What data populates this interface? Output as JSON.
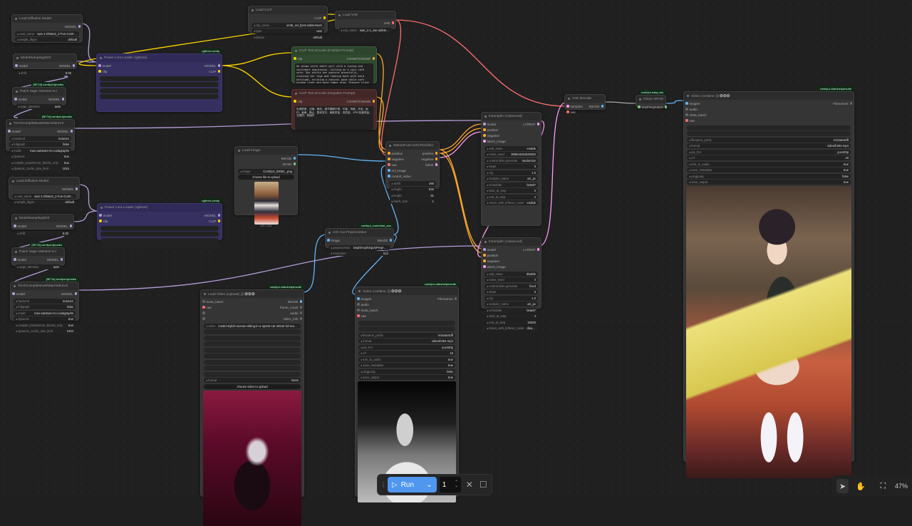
{
  "nodes": [
    {
      "id": "ldm1",
      "title": "Load Diffusion Model",
      "outputs": [
        {
          "label": "MODEL",
          "type": "MODEL"
        }
      ],
      "widgets": [
        {
          "name": "unet_name",
          "value": "wan 2.2\\Wan2_2-Fun-Control-A14B-HIGH_fp8_..."
        },
        {
          "name": "weight_dtype",
          "value": "default"
        }
      ]
    },
    {
      "id": "ms1",
      "title": "ModelSamplingSD3",
      "inputs": [
        {
          "label": "model",
          "type": "MODEL"
        }
      ],
      "outputs": [
        {
          "label": "MODEL",
          "type": "MODEL"
        }
      ],
      "widgets": [
        {
          "name": "shift",
          "value": "8.00"
        }
      ]
    },
    {
      "id": "psa1",
      "title": "Patch Sage Attention KJ",
      "badge": "[SE7A] comfyui-kjnodes",
      "inputs": [
        {
          "label": "model",
          "type": "MODEL"
        }
      ],
      "outputs": [
        {
          "label": "MODEL",
          "type": "MODEL"
        }
      ],
      "widgets": [
        {
          "name": "sage_attention",
          "value": "auto"
        }
      ]
    },
    {
      "id": "tc1",
      "title": "TorchCompileModelWanVideoV2",
      "badge": "[9E7A] comfyui-kjnodes",
      "inputs": [
        {
          "label": "model",
          "type": "MODEL"
        }
      ],
      "outputs": [
        {
          "label": "MODEL",
          "type": "MODEL"
        }
      ],
      "widgets": [
        {
          "name": "backend",
          "value": "inductor"
        },
        {
          "name": "fullgraph",
          "value": "false"
        },
        {
          "name": "mode",
          "value": "max-autotune-no-cudagraphs"
        },
        {
          "name": "dynamic",
          "value": "true"
        },
        {
          "name": "compile_transformer_blocks_only",
          "value": "true"
        },
        {
          "name": "dynamic_cache_size_limit",
          "value": "1024"
        }
      ]
    },
    {
      "id": "pll1",
      "title": "Power Lora Loader (rgthree)",
      "badge": "rgthree-comfy",
      "inputs": [
        {
          "label": "model",
          "type": "MODEL"
        },
        {
          "label": "clip",
          "type": "CLIP"
        }
      ],
      "outputs": [
        {
          "label": "MODEL",
          "type": "MODEL"
        },
        {
          "label": "CLIP",
          "type": "CLIP"
        }
      ],
      "widgets": [
        {
          "name": "",
          "value": ""
        },
        {
          "name": "",
          "value": ""
        },
        {
          "name": "",
          "value": ""
        },
        {
          "name": "",
          "value": ""
        }
      ]
    },
    {
      "id": "clip",
      "title": "Load CLIP",
      "outputs": [
        {
          "label": "CLIP",
          "type": "CLIP"
        }
      ],
      "widgets": [
        {
          "name": "clip_name",
          "value": "umt5_xxl_fp16.safetensors"
        },
        {
          "name": "type",
          "value": "wan"
        },
        {
          "name": "device",
          "value": "default"
        }
      ]
    },
    {
      "id": "vae",
      "title": "Load VAE",
      "outputs": [
        {
          "label": "VAE",
          "type": "VAE"
        }
      ],
      "widgets": [
        {
          "name": "vae_name",
          "value": "wan_2.1_vae.safetensors"
        }
      ]
    },
    {
      "id": "pos",
      "title": "CLIP Text Encode (Positive Prompt)",
      "inputs": [
        {
          "label": "clip",
          "type": "CLIP"
        }
      ],
      "outputs": [
        {
          "label": "CONDITIONING",
          "type": "COND"
        }
      ],
      "text": "An anime-style adult girl with a loving and confident expression, sitting on a cozy café sofa. She shifts her posture gracefully, crossing her legs and leaning back with bold attitude, striking a natural pose while soft window light and warm lamps glow. Glasses clink and drinks move on the table, background customers sit softly, subtle camera motion, expressive detail, professional animation quality."
    },
    {
      "id": "neg",
      "title": "CLIP Text Encode (Negative Prompt)",
      "inputs": [
        {
          "label": "clip",
          "type": "CLIP"
        }
      ],
      "outputs": [
        {
          "label": "CONDITIONING",
          "type": "COND"
        }
      ],
      "text": "色调艳丽，过曝，静态，细节模糊不清，字幕，风格，作品，画作，画面，静止，整体发灰，最差质量，低质量，JPEG压缩残留，丑陋的，残缺的"
    },
    {
      "id": "limg",
      "title": "Load Image",
      "outputs": [
        {
          "label": "IMAGE",
          "type": "IMAGE"
        },
        {
          "label": "MASK",
          "type": "MASK"
        }
      ],
      "widgets": [
        {
          "name": "image",
          "value": "ComfyUI_00002_.png"
        },
        {
          "button": "choose file to upload"
        }
      ],
      "preview": "anime",
      "caption": "480 × 832"
    },
    {
      "id": "wan",
      "title": "Wan22FunControlToVideo",
      "inputs": [
        {
          "label": "positive",
          "type": "COND"
        },
        {
          "label": "negative",
          "type": "COND"
        },
        {
          "label": "vae",
          "type": "VAE"
        },
        {
          "label": "ref_image",
          "type": "IMAGE"
        },
        {
          "label": "control_video",
          "type": "IMAGE"
        }
      ],
      "outputs": [
        {
          "label": "positive",
          "type": "COND"
        },
        {
          "label": "negative",
          "type": "COND"
        },
        {
          "label": "latent",
          "type": "LATENT"
        }
      ],
      "widgets": [
        {
          "name": "width",
          "value": "480"
        },
        {
          "name": "height",
          "value": "832"
        },
        {
          "name": "length",
          "value": "81"
        },
        {
          "name": "batch_size",
          "value": "1"
        }
      ]
    },
    {
      "id": "ks1",
      "title": "KSampler (Advanced)",
      "inputs": [
        {
          "label": "model",
          "type": "MODEL"
        },
        {
          "label": "positive",
          "type": "COND"
        },
        {
          "label": "negative",
          "type": "COND"
        },
        {
          "label": "latent_image",
          "type": "LATENT"
        }
      ],
      "outputs": [
        {
          "label": "LATENT",
          "type": "LATENT"
        }
      ],
      "widgets": [
        {
          "name": "add_noise",
          "value": "enable"
        },
        {
          "name": "noise_seed",
          "value": "386618161826452"
        },
        {
          "name": "control after generate",
          "value": "randomize"
        },
        {
          "name": "steps",
          "value": "8"
        },
        {
          "name": "cfg",
          "value": "1.0"
        },
        {
          "name": "sampler_name",
          "value": "uni_pc"
        },
        {
          "name": "scheduler",
          "value": "beta57"
        },
        {
          "name": "start_at_step",
          "value": "0"
        },
        {
          "name": "end_at_step",
          "value": "4"
        },
        {
          "name": "return_with_leftover_noise",
          "value": "enable"
        }
      ]
    },
    {
      "id": "ks2",
      "title": "KSampler (Advanced)",
      "inputs": [
        {
          "label": "model",
          "type": "MODEL"
        },
        {
          "label": "positive",
          "type": "COND"
        },
        {
          "label": "negative",
          "type": "COND"
        },
        {
          "label": "latent_image",
          "type": "LATENT"
        }
      ],
      "outputs": [
        {
          "label": "LATENT",
          "type": "LATENT"
        }
      ],
      "widgets": [
        {
          "name": "add_noise",
          "value": "disable"
        },
        {
          "name": "noise_seed",
          "value": "0"
        },
        {
          "name": "control after generate",
          "value": "fixed"
        },
        {
          "name": "steps",
          "value": "8"
        },
        {
          "name": "cfg",
          "value": "1.0"
        },
        {
          "name": "sampler_name",
          "value": "uni_pc"
        },
        {
          "name": "scheduler",
          "value": "beta57"
        },
        {
          "name": "start_at_step",
          "value": "4"
        },
        {
          "name": "end_at_step",
          "value": "10000"
        },
        {
          "name": "return_with_leftover_noise",
          "value": "disable"
        }
      ]
    },
    {
      "id": "vaed",
      "title": "VAE Decode",
      "inputs": [
        {
          "label": "samples",
          "type": "LATENT"
        },
        {
          "label": "vae",
          "type": "VAE"
        }
      ],
      "outputs": [
        {
          "label": "IMAGE",
          "type": "IMAGE"
        }
      ]
    },
    {
      "id": "cvram",
      "title": "Clean VRAM",
      "badge": "comfyui-easy-use",
      "inputs": [
        {
          "label": "anything",
          "type": "ANY"
        }
      ],
      "outputs": [
        {
          "label": "output",
          "type": "ANY"
        }
      ]
    },
    {
      "id": "vc1",
      "title": "Video Combine 🎥🅥🅗🅢",
      "badge": "comfyui-videohelpersuite",
      "inputs": [
        {
          "label": "images",
          "type": "IMAGE"
        },
        {
          "label": "audio",
          "type": "NONE"
        },
        {
          "label": "meta_batch",
          "type": "NONE"
        },
        {
          "label": "vae",
          "type": "VAE"
        }
      ],
      "outputs": [
        {
          "label": "Filenames",
          "type": "NONE"
        }
      ],
      "widgets": [
        {
          "empty": true
        },
        {
          "empty": true
        },
        {
          "name": "filename_prefix",
          "value": "AnimateDiff"
        },
        {
          "name": "format",
          "value": "video/h264-mp4"
        },
        {
          "name": "pix_fmt",
          "value": "yuv420p"
        },
        {
          "name": "crf",
          "value": "19"
        },
        {
          "name": "trim_to_audio",
          "value": "true"
        },
        {
          "name": "save_metadata",
          "value": "true"
        },
        {
          "name": "pingpong",
          "value": "false"
        },
        {
          "name": "save_output",
          "value": "true"
        }
      ],
      "preview": "anime-large"
    },
    {
      "id": "ldm2",
      "title": "Load Diffusion Model",
      "outputs": [
        {
          "label": "MODEL",
          "type": "MODEL"
        }
      ],
      "widgets": [
        {
          "name": "unet_name",
          "value": "wan 2.2\\Wan2_2-Fun-Control-A14B-LOW_fp8_..."
        },
        {
          "name": "weight_dtype",
          "value": "default"
        }
      ]
    },
    {
      "id": "ms2",
      "title": "ModelSamplingSD3",
      "inputs": [
        {
          "label": "model",
          "type": "MODEL"
        }
      ],
      "outputs": [
        {
          "label": "MODEL",
          "type": "MODEL"
        }
      ],
      "widgets": [
        {
          "name": "shift",
          "value": "8.00"
        }
      ]
    },
    {
      "id": "psa2",
      "title": "Patch Sage Attention KJ",
      "badge": "[SE7A] comfyui-kjnodes",
      "inputs": [
        {
          "label": "model",
          "type": "MODEL"
        }
      ],
      "outputs": [
        {
          "label": "MODEL",
          "type": "MODEL"
        }
      ],
      "widgets": [
        {
          "name": "sage_attention",
          "value": "auto"
        }
      ]
    },
    {
      "id": "tc2",
      "title": "TorchCompileModelWanVideoV2",
      "badge": "[9E7A] comfyui-kjnodes",
      "inputs": [
        {
          "label": "model",
          "type": "MODEL"
        }
      ],
      "outputs": [
        {
          "label": "MODEL",
          "type": "MODEL"
        }
      ],
      "widgets": [
        {
          "name": "backend",
          "value": "inductor"
        },
        {
          "name": "fullgraph",
          "value": "false"
        },
        {
          "name": "mode",
          "value": "max-autotune-no-cudagraphs"
        },
        {
          "name": "dynamic",
          "value": "true"
        },
        {
          "name": "compile_transformer_blocks_only",
          "value": "true"
        },
        {
          "name": "dynamic_cache_size_limit",
          "value": "1024"
        }
      ]
    },
    {
      "id": "pll2",
      "title": "Power Lora Loader (rgthree)",
      "badge": "rgthree-comfy",
      "inputs": [
        {
          "label": "model",
          "type": "MODEL"
        },
        {
          "label": "clip",
          "type": "CLIP"
        }
      ],
      "outputs": [
        {
          "label": "MODEL",
          "type": "MODEL"
        },
        {
          "label": "CLIP",
          "type": "CLIP"
        }
      ],
      "widgets": [
        {
          "name": "",
          "value": ""
        },
        {
          "name": "",
          "value": ""
        },
        {
          "name": "",
          "value": ""
        },
        {
          "name": "",
          "value": ""
        }
      ]
    },
    {
      "id": "aio",
      "title": "AIO Aux Preprocessor",
      "badge": "comfyui_controlnet_aux",
      "inputs": [
        {
          "label": "image",
          "type": "IMAGE"
        }
      ],
      "outputs": [
        {
          "label": "IMAGE",
          "type": "IMAGE"
        }
      ],
      "widgets": [
        {
          "name": "preprocessor",
          "value": "DepthAnythingV2Preprocessor"
        },
        {
          "name": "resolution",
          "value": "512"
        }
      ]
    },
    {
      "id": "lvid",
      "title": "Load Video (Upload) 🎥🅥🅗🅢",
      "badge": "comfyui-videohelpersuite",
      "inputs": [
        {
          "label": "meta_batch",
          "type": "NONE"
        },
        {
          "label": "vae",
          "type": "VAE"
        },
        {
          "label": "",
          "type": "NONE"
        },
        {
          "label": "",
          "type": "NONE"
        }
      ],
      "outputs": [
        {
          "label": "IMAGE",
          "type": "IMAGE"
        },
        {
          "label": "frame_count",
          "type": "NONE"
        },
        {
          "label": "audio",
          "type": "NONE"
        },
        {
          "label": "video_info",
          "type": "NONE"
        }
      ],
      "widgets": [
        {
          "name": "video",
          "value": "model-stylish-woman-sitting-in-a-sports-car-44542-hd-ready.mp4"
        },
        {
          "empty": true
        },
        {
          "empty": true
        },
        {
          "empty": true
        },
        {
          "empty": true
        },
        {
          "empty": true
        },
        {
          "empty": true
        },
        {
          "empty": true
        },
        {
          "empty": true
        },
        {
          "name": "format",
          "value": "None"
        },
        {
          "button": "choose video to upload"
        }
      ],
      "preview": "car"
    },
    {
      "id": "vc2",
      "title": "Video Combine 🎥🅥🅗🅢",
      "badge": "comfyui-videohelpersuite",
      "inputs": [
        {
          "label": "images",
          "type": "IMAGE"
        },
        {
          "label": "audio",
          "type": "NONE"
        },
        {
          "label": "meta_batch",
          "type": "NONE"
        },
        {
          "label": "vae",
          "type": "VAE"
        }
      ],
      "outputs": [
        {
          "label": "Filenames",
          "type": "NONE"
        }
      ],
      "widgets": [
        {
          "empty": true
        },
        {
          "empty": true
        },
        {
          "name": "filename_prefix",
          "value": "AnimateDiff"
        },
        {
          "name": "format",
          "value": "video/h264-mp4"
        },
        {
          "name": "pix_fmt",
          "value": "yuv420p"
        },
        {
          "name": "crf",
          "value": "19"
        },
        {
          "name": "trim_to_audio",
          "value": "true"
        },
        {
          "name": "save_metadata",
          "value": "true"
        },
        {
          "name": "pingpong",
          "value": "false"
        },
        {
          "name": "save_output",
          "value": "true"
        }
      ],
      "preview": "depth"
    }
  ],
  "slot_colors": {
    "MODEL": "#b39ddb",
    "CLIP": "#ffd500",
    "VAE": "#ff6e6e",
    "COND": "#ffa931",
    "LATENT": "#ff9cf9",
    "IMAGE": "#64b5f6",
    "MASK": "#81c784",
    "ANY": "#7ccf7c",
    "NONE": "#666666"
  },
  "toolbar": {
    "run_label": "Run",
    "queue_count": "1"
  },
  "canvas_controls": {
    "zoom": "47%"
  }
}
